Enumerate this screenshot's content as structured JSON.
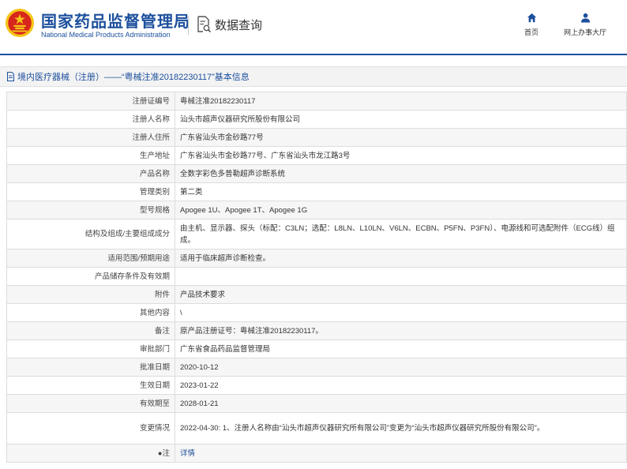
{
  "header": {
    "brand_cn": "国家药品监督管理局",
    "brand_en": "National Medical Products Administration",
    "query_title": "数据查询",
    "nav": [
      {
        "label": "首页",
        "icon": "home-icon"
      },
      {
        "label": "网上办事大厅",
        "icon": "user-icon"
      }
    ]
  },
  "section": {
    "title": "境内医疗器械（注册）——“粤械注准20182230117”基本信息"
  },
  "details": {
    "rows": [
      {
        "label": "注册证编号",
        "value": "粤械注准20182230117"
      },
      {
        "label": "注册人名称",
        "value": "汕头市超声仪器研究所股份有限公司"
      },
      {
        "label": "注册人住所",
        "value": "广东省汕头市金砂路77号"
      },
      {
        "label": "生产地址",
        "value": "广东省汕头市金砂路77号、广东省汕头市龙江路3号"
      },
      {
        "label": "产品名称",
        "value": "全数字彩色多普勒超声诊断系统"
      },
      {
        "label": "管理类别",
        "value": "第二类"
      },
      {
        "label": "型号规格",
        "value": "Apogee 1U、Apogee 1T、Apogee 1G"
      },
      {
        "label": "结构及组成/主要组成成分",
        "value": "由主机、显示器、探头（标配：C3LN；选配：L8LN、L10LN、V6LN、ECBN、P5FN、P3FN）、电源线和可选配附件（ECG线）组成。"
      },
      {
        "label": "适用范围/预期用途",
        "value": "适用于临床超声诊断检查。"
      },
      {
        "label": "产品储存条件及有效期",
        "value": ""
      },
      {
        "label": "附件",
        "value": "产品技术要求"
      },
      {
        "label": "其他内容",
        "value": "\\"
      },
      {
        "label": "备注",
        "value": "原产品注册证号：粤械注准20182230117。"
      },
      {
        "label": "审批部门",
        "value": "广东省食品药品监督管理局"
      },
      {
        "label": "批准日期",
        "value": "2020-10-12"
      },
      {
        "label": "生效日期",
        "value": "2023-01-22"
      },
      {
        "label": "有效期至",
        "value": "2028-01-21"
      },
      {
        "label": "变更情况",
        "value": "2022-04-30: 1、注册人名称由“汕头市超声仪器研究所有限公司”变更为“汕头市超声仪器研究所股份有限公司”。"
      },
      {
        "label": "注",
        "value": "详情"
      }
    ]
  },
  "colors": {
    "brand_blue": "#1c4f9c",
    "emblem_red": "#d7261b",
    "emblem_gold": "#f5c518"
  }
}
